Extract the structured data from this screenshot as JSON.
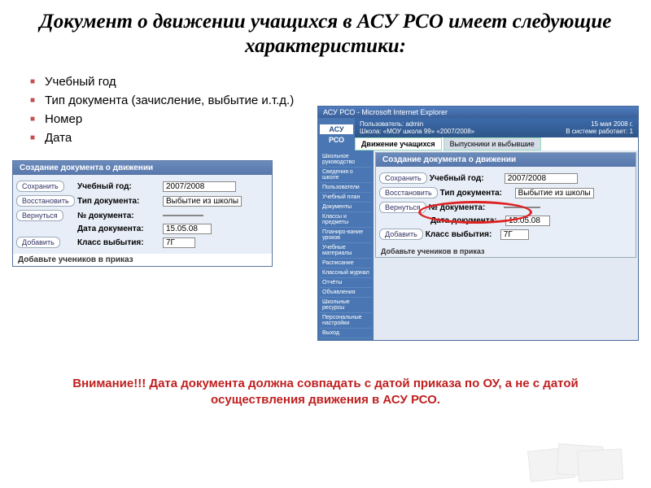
{
  "title": "Документ о движении учащихся в АСУ РСО имеет следующие характеристики:",
  "bullets": [
    "Учебный год",
    "Тип документа (зачисление, выбытие и.т.д.)",
    "Номер",
    "Дата"
  ],
  "left_panel": {
    "header": "Создание документа о движении",
    "buttons": {
      "save": "Сохранить",
      "restore": "Восстановить",
      "back": "Вернуться",
      "add": "Добавить"
    },
    "rows": {
      "year_lbl": "Учебный год:",
      "year_val": "2007/2008",
      "type_lbl": "Тип документа:",
      "type_val": "Выбытие из школы",
      "num_lbl": "№ документа:",
      "num_val": "",
      "date_lbl": "Дата документа:",
      "date_val": "15.05.08",
      "class_lbl": "Класс выбытия:",
      "class_val": "7Г"
    },
    "note": "Добавьте учеников в приказ"
  },
  "right_panel": {
    "chrome": "АСУ РСО - Microsoft Internet Explorer",
    "user": "Пользователь: admin",
    "school": "Школа: «МОУ школа 99»   «2007/2008»",
    "date": "15 мая 2008 г.",
    "session": "В системе работает: 1",
    "logo_t": "АСУ",
    "logo_b": "РСО",
    "tab1": "Движение учащихся",
    "tab2": "Выпускники и выбывшие",
    "inner_header": "Создание документа о движении",
    "sidebar": [
      "Школьное руководство",
      "Сведения о школе",
      "Пользователи",
      "Учебный план",
      "Документы",
      "Классы и предметы",
      "Планиро-вание уроков",
      "Учебные материалы",
      "Расписание",
      "Классный журнал",
      "Отчёты",
      "Объявления",
      "Школьные ресурсы",
      "Персональные настройки",
      "Выход"
    ],
    "buttons": {
      "save": "Сохранить",
      "restore": "Восстановить",
      "back": "Вернуться",
      "add": "Добавить"
    },
    "rows": {
      "year_lbl": "Учебный год:",
      "year_val": "2007/2008",
      "type_lbl": "Тип документа:",
      "type_val": "Выбытие из школы",
      "num_lbl": "№ документа:",
      "date_lbl": "Дата документа:",
      "date_val": "15.05.08",
      "class_lbl": "Класс выбытия:",
      "class_val": "7Г"
    },
    "note": "Добавьте учеников в приказ"
  },
  "footer": "Внимание!!! Дата документа должна совпадать с датой приказа по ОУ, а не с датой осуществления движения в АСУ РСО."
}
